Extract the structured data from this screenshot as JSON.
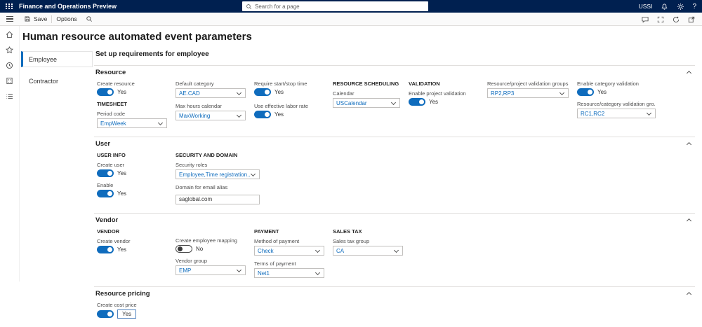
{
  "colors": {
    "topbar": "#002050",
    "accent": "#0f6cbd"
  },
  "topbar": {
    "app_title": "Finance and Operations Preview",
    "search_placeholder": "Search for a page",
    "company": "USSI",
    "help_label": "?"
  },
  "toolbar": {
    "save": "Save",
    "options": "Options"
  },
  "page": {
    "title": "Human resource automated event parameters",
    "content_header": "Set up requirements for employee",
    "tabs": [
      {
        "label": "Employee"
      },
      {
        "label": "Contractor"
      }
    ]
  },
  "resource": {
    "title": "Resource",
    "create_resource": {
      "label": "Create resource",
      "value": "Yes"
    },
    "timesheet_header": "TIMESHEET",
    "period_code": {
      "label": "Period code",
      "value": "EmpWeek"
    },
    "default_category": {
      "label": "Default category",
      "value": "AE.CAD"
    },
    "max_hours_calendar": {
      "label": "Max hours calendar",
      "value": "MaxWorking"
    },
    "require_start_stop": {
      "label": "Require start/stop time",
      "value": "Yes"
    },
    "use_effective_labor_rate": {
      "label": "Use effective labor rate",
      "value": "Yes"
    },
    "resource_scheduling_header": "RESOURCE SCHEDULING",
    "calendar": {
      "label": "Calendar",
      "value": "USCalendar"
    },
    "validation_header": "VALIDATION",
    "enable_project_validation": {
      "label": "Enable project validation",
      "value": "Yes"
    },
    "resource_project_validation_groups": {
      "label": "Resource/project validation groups",
      "value": "RP2,RP3"
    },
    "enable_category_validation": {
      "label": "Enable category validation",
      "value": "Yes"
    },
    "resource_category_validation_groups": {
      "label": "Resource/category validation gro...",
      "value": "RC1,RC2"
    }
  },
  "user": {
    "title": "User",
    "user_info_header": "USER INFO",
    "create_user": {
      "label": "Create user",
      "value": "Yes"
    },
    "enable": {
      "label": "Enable",
      "value": "Yes"
    },
    "security_header": "SECURITY AND DOMAIN",
    "security_roles": {
      "label": "Security roles",
      "value": "Employee,Time registration..."
    },
    "domain_for_email_alias": {
      "label": "Domain for email alias",
      "value": "saglobal.com"
    }
  },
  "vendor": {
    "title": "Vendor",
    "vendor_header": "VENDOR",
    "create_vendor": {
      "label": "Create vendor",
      "value": "Yes"
    },
    "create_employee_mapping": {
      "label": "Create employee mapping",
      "value": "No"
    },
    "vendor_group": {
      "label": "Vendor group",
      "value": "EMP"
    },
    "payment_header": "PAYMENT",
    "method_of_payment": {
      "label": "Method of payment",
      "value": "Check"
    },
    "terms_of_payment": {
      "label": "Terms of payment",
      "value": "Net1"
    },
    "sales_tax_header": "SALES TAX",
    "sales_tax_group": {
      "label": "Sales tax group",
      "value": "CA"
    }
  },
  "resource_pricing": {
    "title": "Resource pricing",
    "create_cost_price": {
      "label": "Create cost price",
      "value": "Yes"
    }
  }
}
